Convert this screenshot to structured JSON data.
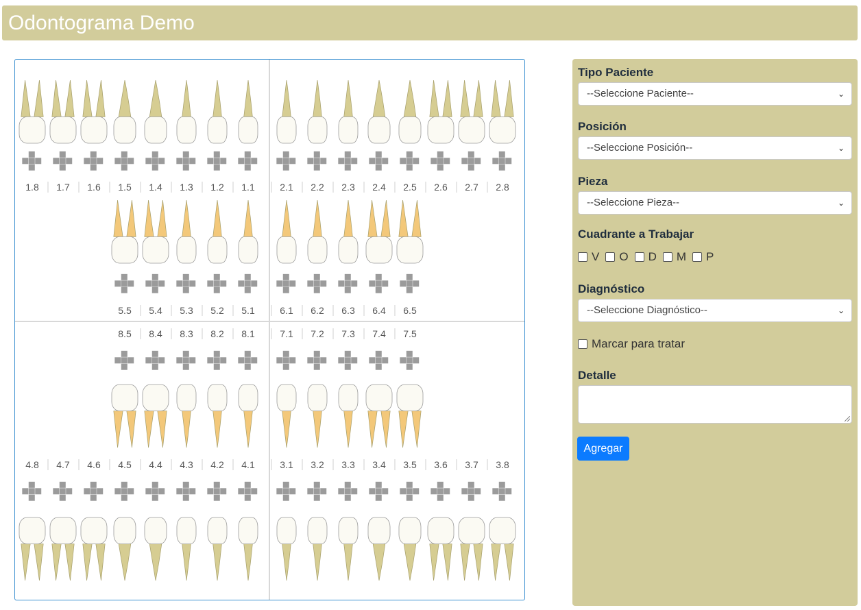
{
  "app": {
    "title": "Odontograma Demo"
  },
  "colors": {
    "header_bg": "#d2cc9b",
    "panel_bg": "#d2cc9b",
    "chart_border": "#3a8fd0",
    "surface_gray": "#9b9b9b",
    "button_bg": "#0b7bff",
    "permanent_crown": "#fbfaf3",
    "permanent_root": "#d6cd92",
    "deciduous_root": "#f3c87a"
  },
  "odontogram": {
    "upper_permanent": [
      "1.8",
      "1.7",
      "1.6",
      "1.5",
      "1.4",
      "1.3",
      "1.2",
      "1.1",
      "2.1",
      "2.2",
      "2.3",
      "2.4",
      "2.5",
      "2.6",
      "2.7",
      "2.8"
    ],
    "upper_deciduous": [
      "5.5",
      "5.4",
      "5.3",
      "5.2",
      "5.1",
      "6.1",
      "6.2",
      "6.3",
      "6.4",
      "6.5"
    ],
    "lower_deciduous": [
      "8.5",
      "8.4",
      "8.3",
      "8.2",
      "8.1",
      "7.1",
      "7.2",
      "7.3",
      "7.4",
      "7.5"
    ],
    "lower_permanent": [
      "4.8",
      "4.7",
      "4.6",
      "4.5",
      "4.4",
      "4.3",
      "4.2",
      "4.1",
      "3.1",
      "3.2",
      "3.3",
      "3.4",
      "3.5",
      "3.6",
      "3.7",
      "3.8"
    ]
  },
  "form": {
    "tipo_paciente": {
      "label": "Tipo Paciente",
      "value": "--Seleccione Paciente--"
    },
    "posicion": {
      "label": "Posición",
      "value": "--Seleccione Posición--"
    },
    "pieza": {
      "label": "Pieza",
      "value": "--Seleccione Pieza--"
    },
    "cuadrante": {
      "label": "Cuadrante a Trabajar",
      "options": [
        "V",
        "O",
        "D",
        "M",
        "P"
      ]
    },
    "diagnostico": {
      "label": "Diagnóstico",
      "value": "--Seleccione Diagnóstico--"
    },
    "marcar": {
      "label": "Marcar para tratar"
    },
    "detalle": {
      "label": "Detalle",
      "value": ""
    },
    "agregar": {
      "label": "Agregar"
    }
  }
}
